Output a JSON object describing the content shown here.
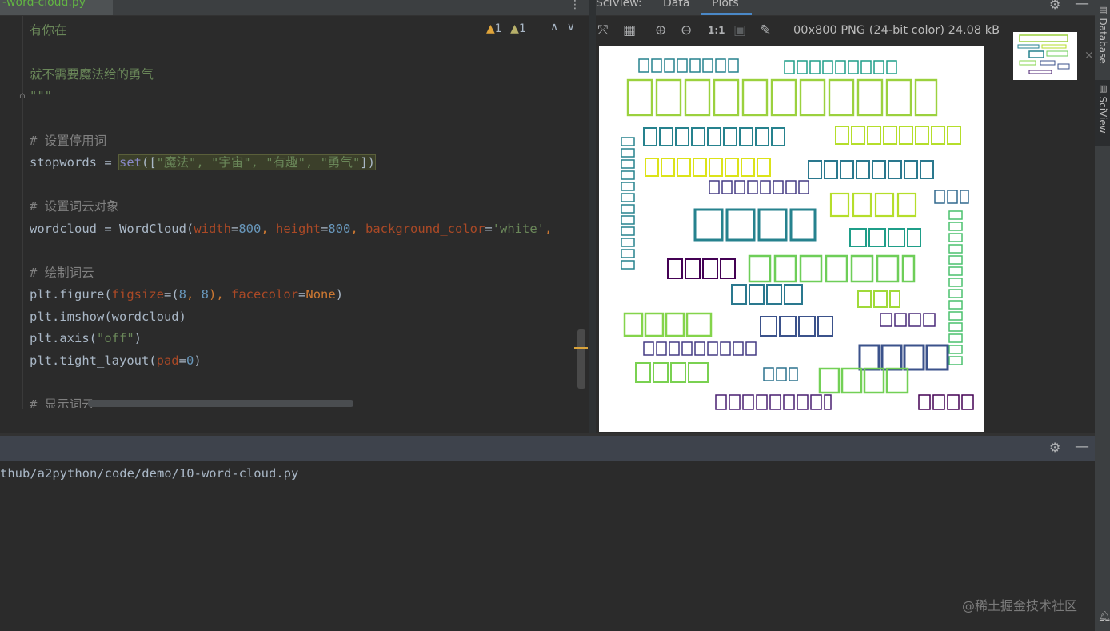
{
  "editor": {
    "tab_title": "-word-cloud.py",
    "menu_glyph": "⋮",
    "inspect": {
      "warn1_glyph": "▲",
      "warn1": "1",
      "warn2_glyph": "▲",
      "warn2": "1"
    },
    "nav_up": "∧",
    "nav_down": "∨",
    "lines": {
      "l1": "有你在",
      "l2": "就不需要魔法给的勇气",
      "l3": "\"\"\"",
      "l4": "# 设置停用词",
      "l5a": "stopwords = ",
      "l5b": "set",
      "l5c": "([",
      "l5d": "\"魔法\", \"宇宙\", \"有趣\", \"勇气\"",
      "l5e": "])",
      "l6": "# 设置词云对象",
      "l7a": "wordcloud = WordCloud(",
      "l7b": "width",
      "l7c": "=",
      "l7d": "800",
      "l7e": ", ",
      "l7f": "height",
      "l7g": "=",
      "l7h": "800",
      "l7i": ", ",
      "l7j": "background_color",
      "l7k": "=",
      "l7l": "'white'",
      "l7m": ",",
      "l8": "# 绘制词云",
      "l9a": "plt.figure(",
      "l9b": "figsize",
      "l9c": "=(",
      "l9d": "8",
      "l9e": ", ",
      "l9f": "8",
      "l9g": "), ",
      "l9h": "facecolor",
      "l9i": "=",
      "l9j": "None",
      "l9k": ")",
      "l10": "plt.imshow(wordcloud)",
      "l11a": "plt.axis(",
      "l11b": "\"off\"",
      "l11c": ")",
      "l12a": "plt.tight_layout(",
      "l12b": "pad",
      "l12c": "=",
      "l12d": "0",
      "l12e": ")",
      "l13": "# 显示词云"
    }
  },
  "sciview": {
    "title": "SciView:",
    "tab_data": "Data",
    "tab_plots": "Plots",
    "image_info": "00x800 PNG (24-bit color) 24.08 kB",
    "thumb_close": "✕"
  },
  "toolwindows": {
    "database": "Database",
    "sciview": "SciView"
  },
  "run": {
    "path": "thub/a2python/code/demo/10-word-cloud.py"
  },
  "watermark": "@稀土掘金技术社区",
  "colors": {
    "green_bright": "#9bd13e",
    "teal": "#26828e",
    "dark_purple": "#440154",
    "navy": "#3b528b",
    "yellow": "#dce319"
  }
}
